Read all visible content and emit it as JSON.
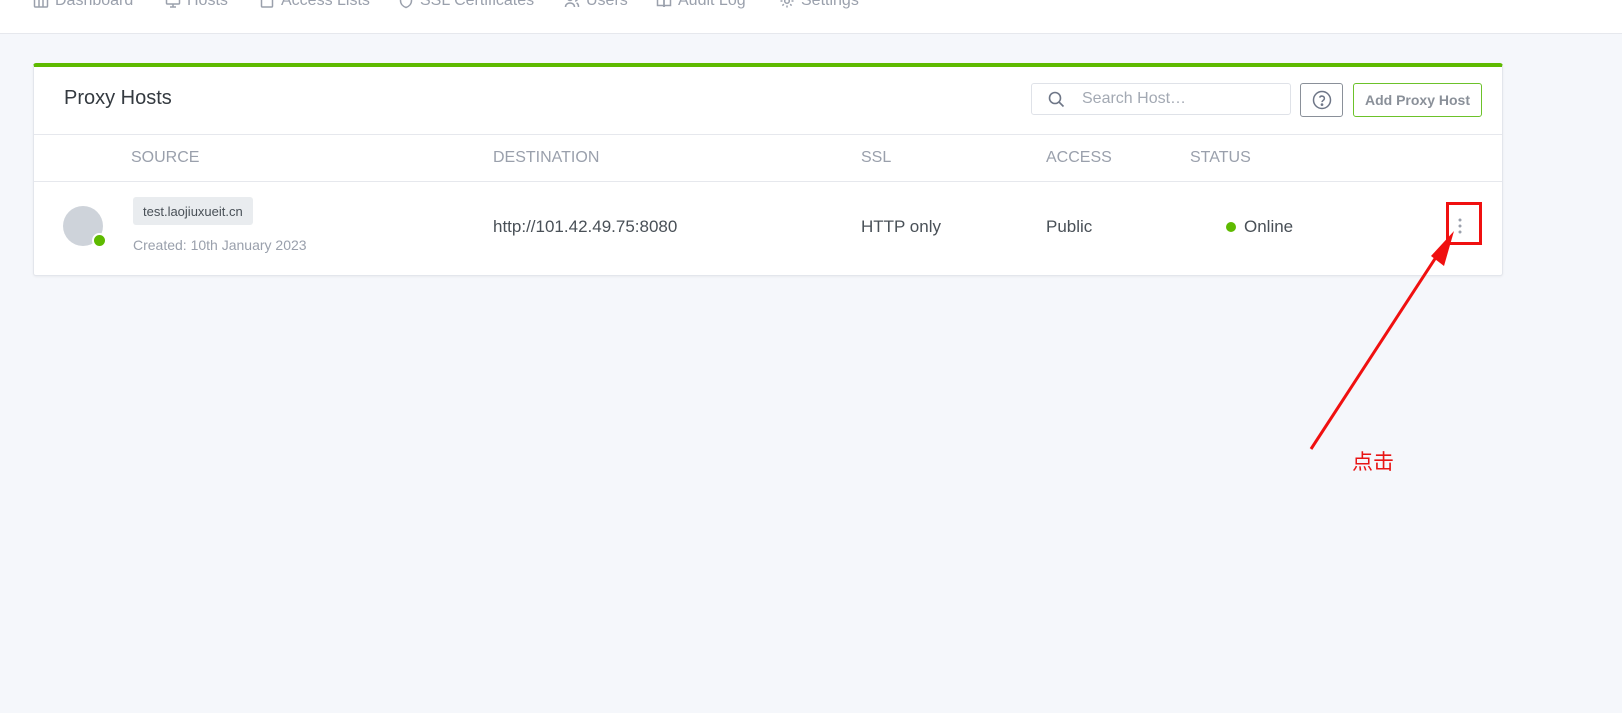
{
  "nav": {
    "items": [
      {
        "label": "Dashboard",
        "icon": "dashboard-icon"
      },
      {
        "label": "Hosts",
        "icon": "monitor-icon"
      },
      {
        "label": "Access Lists",
        "icon": "lock-icon"
      },
      {
        "label": "SSL Certificates",
        "icon": "shield-icon"
      },
      {
        "label": "Users",
        "icon": "users-icon"
      },
      {
        "label": "Audit Log",
        "icon": "book-icon"
      },
      {
        "label": "Settings",
        "icon": "gear-icon"
      }
    ]
  },
  "card": {
    "title": "Proxy Hosts",
    "search_placeholder": "Search Host…",
    "add_button_label": "Add Proxy Host"
  },
  "table": {
    "columns": [
      "SOURCE",
      "DESTINATION",
      "SSL",
      "ACCESS",
      "STATUS"
    ],
    "rows": [
      {
        "source": "test.laojiuxueit.cn",
        "created": "Created: 10th January 2023",
        "destination": "http://101.42.49.75:8080",
        "ssl": "HTTP only",
        "access": "Public",
        "status": "Online"
      }
    ]
  },
  "annotation": {
    "label": "点击",
    "color": "#e81414"
  },
  "colors": {
    "accent": "#5eba00",
    "online": "#5eba00"
  }
}
